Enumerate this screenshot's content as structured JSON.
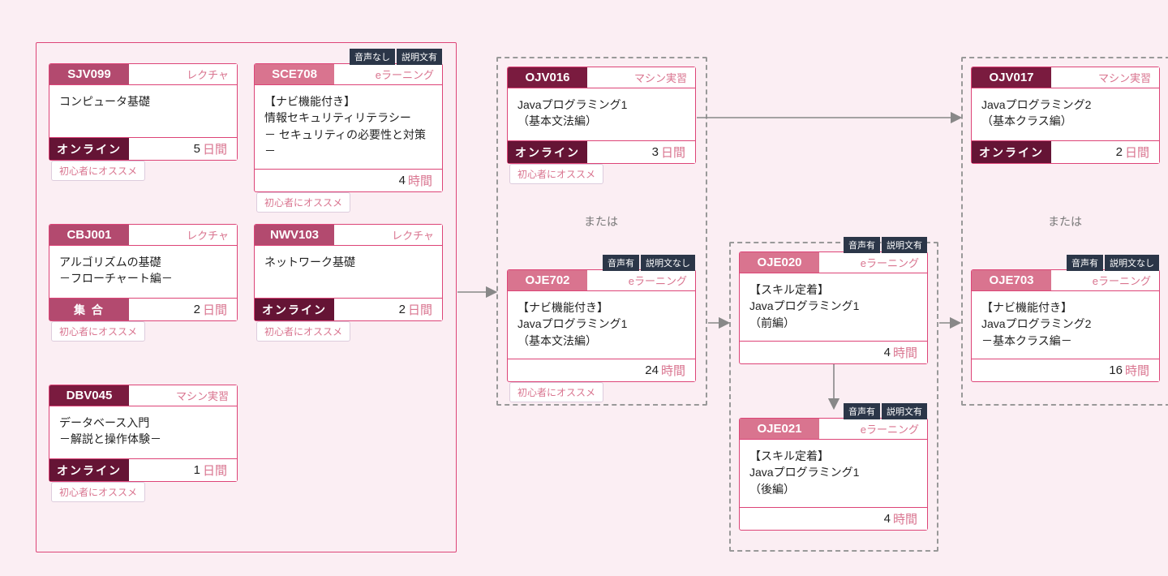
{
  "labels": {
    "or": "または"
  },
  "flags": {
    "voice_no": "音声なし",
    "voice_yes": "音声有",
    "desc_yes": "説明文有",
    "desc_no": "説明文なし"
  },
  "reco": "初心者にオススメ",
  "cards": {
    "sjv099": {
      "code": "SJV099",
      "style": "レクチャ",
      "title": "コンピュータ基礎",
      "delivery": "オンライン",
      "dur_n": "5",
      "dur_u": "日間"
    },
    "sce708": {
      "code": "SCE708",
      "style": "eラーニング",
      "title": "【ナビ機能付き】\n情報セキュリティリテラシー\n－ セキュリティの必要性と対策－",
      "dur_n": "4",
      "dur_u": "時間"
    },
    "cbj001": {
      "code": "CBJ001",
      "style": "レクチャ",
      "title": "アルゴリズムの基礎\n－フローチャート編－",
      "delivery": "集 合",
      "dur_n": "2",
      "dur_u": "日間"
    },
    "nwv103": {
      "code": "NWV103",
      "style": "レクチャ",
      "title": "ネットワーク基礎",
      "delivery": "オンライン",
      "dur_n": "2",
      "dur_u": "日間"
    },
    "dbv045": {
      "code": "DBV045",
      "style": "マシン実習",
      "title": "データベース入門\n－解説と操作体験－",
      "delivery": "オンライン",
      "dur_n": "1",
      "dur_u": "日間"
    },
    "ojv016": {
      "code": "OJV016",
      "style": "マシン実習",
      "title": "Javaプログラミング1\n（基本文法編）",
      "delivery": "オンライン",
      "dur_n": "3",
      "dur_u": "日間"
    },
    "oje702": {
      "code": "OJE702",
      "style": "eラーニング",
      "title": "【ナビ機能付き】\nJavaプログラミング1\n（基本文法編）",
      "dur_n": "24",
      "dur_u": "時間"
    },
    "oje020": {
      "code": "OJE020",
      "style": "eラーニング",
      "title": "【スキル定着】\nJavaプログラミング1\n（前編）",
      "dur_n": "4",
      "dur_u": "時間"
    },
    "oje021": {
      "code": "OJE021",
      "style": "eラーニング",
      "title": "【スキル定着】\nJavaプログラミング1\n（後編）",
      "dur_n": "4",
      "dur_u": "時間"
    },
    "ojv017": {
      "code": "OJV017",
      "style": "マシン実習",
      "title": "Javaプログラミング2\n（基本クラス編）",
      "delivery": "オンライン",
      "dur_n": "2",
      "dur_u": "日間"
    },
    "oje703": {
      "code": "OJE703",
      "style": "eラーニング",
      "title": "【ナビ機能付き】\nJavaプログラミング2\n－基本クラス編－",
      "dur_n": "16",
      "dur_u": "時間"
    }
  }
}
